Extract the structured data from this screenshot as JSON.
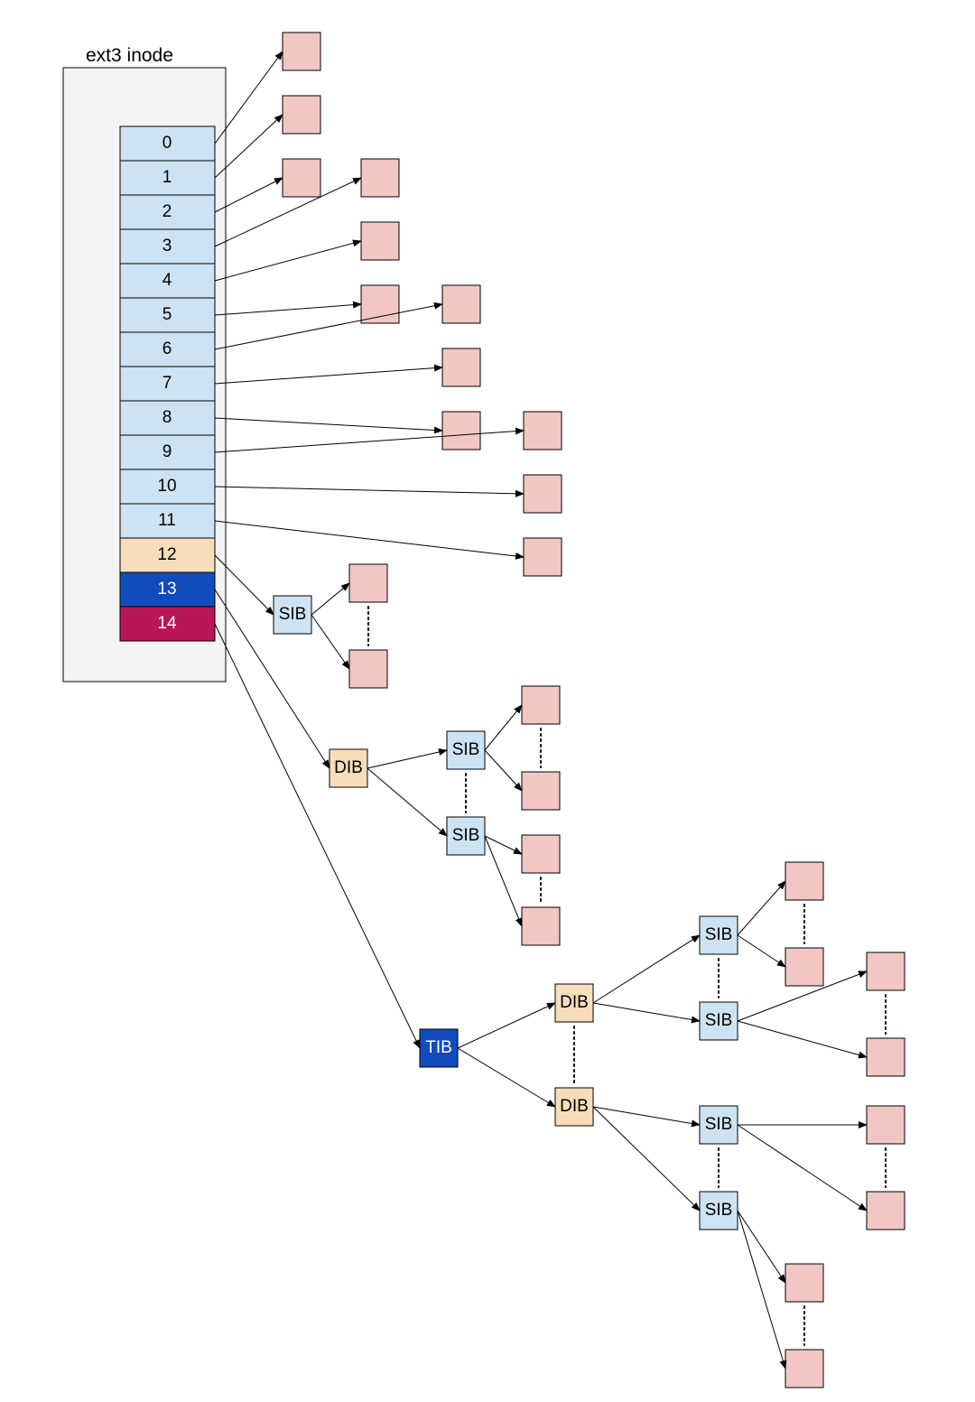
{
  "title": "ext3 inode",
  "pointer_table": {
    "direct": [
      "0",
      "1",
      "2",
      "3",
      "4",
      "5",
      "6",
      "7",
      "8",
      "9",
      "10",
      "11"
    ],
    "single_indirect": "12",
    "double_indirect": "13",
    "triple_indirect": "14"
  },
  "labels": {
    "sib": "SIB",
    "dib": "DIB",
    "tib": "TIB"
  },
  "colors": {
    "direct_cell": "#cde3f3",
    "single_indirect_cell": "#f8ddbb",
    "double_indirect_cell": "#124bbb",
    "triple_indirect_cell": "#b91657",
    "data_block": "#f1c6c3",
    "sib_block": "#cde3f3",
    "dib_block": "#f8ddbb",
    "tib_block": "#124bbb"
  }
}
